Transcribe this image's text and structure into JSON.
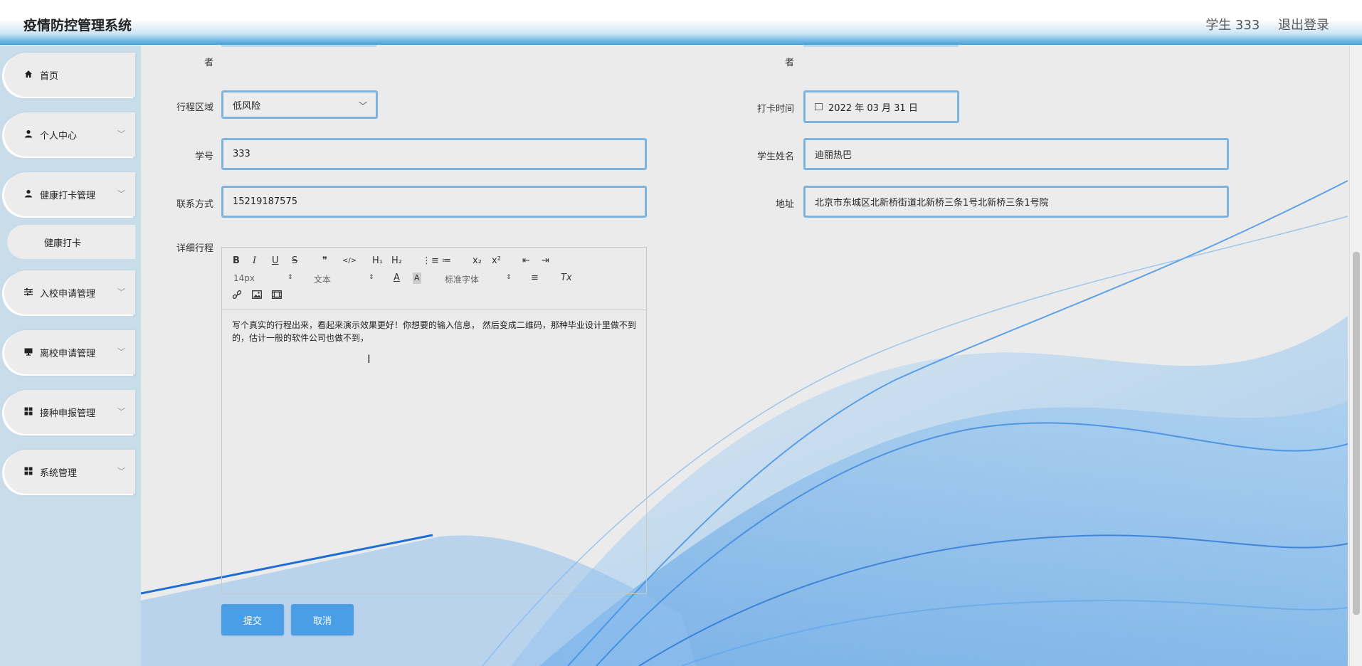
{
  "header": {
    "title": "疫情防控管理系统",
    "user_label": "学生 333",
    "logout_label": "退出登录"
  },
  "sidebar": {
    "items": [
      {
        "label": "首页",
        "icon": "home-icon"
      },
      {
        "label": "个人中心",
        "icon": "user-icon"
      },
      {
        "label": "健康打卡管理",
        "icon": "user-icon"
      },
      {
        "label": "入校申请管理",
        "icon": "sliders-icon"
      },
      {
        "label": "离校申请管理",
        "icon": "monitor-icon"
      },
      {
        "label": "接种申报管理",
        "icon": "grid-icon"
      },
      {
        "label": "系统管理",
        "icon": "grid-icon"
      }
    ],
    "submenu": {
      "label": "健康打卡"
    }
  },
  "form": {
    "truncated_left": "者",
    "truncated_right": "者",
    "region_label": "行程区域",
    "region_value": "低风险",
    "checkin_time_label": "打卡时间",
    "checkin_time_value": "2022 年 03 月 31 日",
    "student_id_label": "学号",
    "student_id_value": "333",
    "student_name_label": "学生姓名",
    "student_name_value": "迪丽热巴",
    "contact_label": "联系方式",
    "contact_value": "15219187575",
    "address_label": "地址",
    "address_value": "北京市东城区北新桥街道北新桥三条1号北新桥三条1号院",
    "itinerary_label": "详细行程"
  },
  "editor": {
    "toolbar": {
      "bold": "B",
      "italic": "I",
      "underline": "U",
      "strike": "S",
      "quote": "❞",
      "code": "</>",
      "h1": "H₁",
      "h2": "H₂",
      "ordered_list": "⋮≡",
      "bullet_list": "≔",
      "subscript": "x₂",
      "superscript": "x²",
      "outdent": "⇤",
      "indent": "⇥",
      "size_value": "14px",
      "type_value": "文本",
      "font_value": "标准字体",
      "color": "A",
      "background": "A",
      "align": "≡",
      "clean": "Tx",
      "link": "🔗",
      "image": "▣",
      "video": "▤"
    },
    "content": "写个真实的行程出来，看起来演示效果更好！你想要的输入信息， 然后变成二维码，那种毕业设计里做不到的，估计一般的软件公司也做不到，"
  },
  "actions": {
    "submit_label": "提交",
    "cancel_label": "取消"
  },
  "colors": {
    "accent": "#4a9ee6",
    "field_border": "#7db3df",
    "sidebar_bg": "#c9dcea"
  }
}
